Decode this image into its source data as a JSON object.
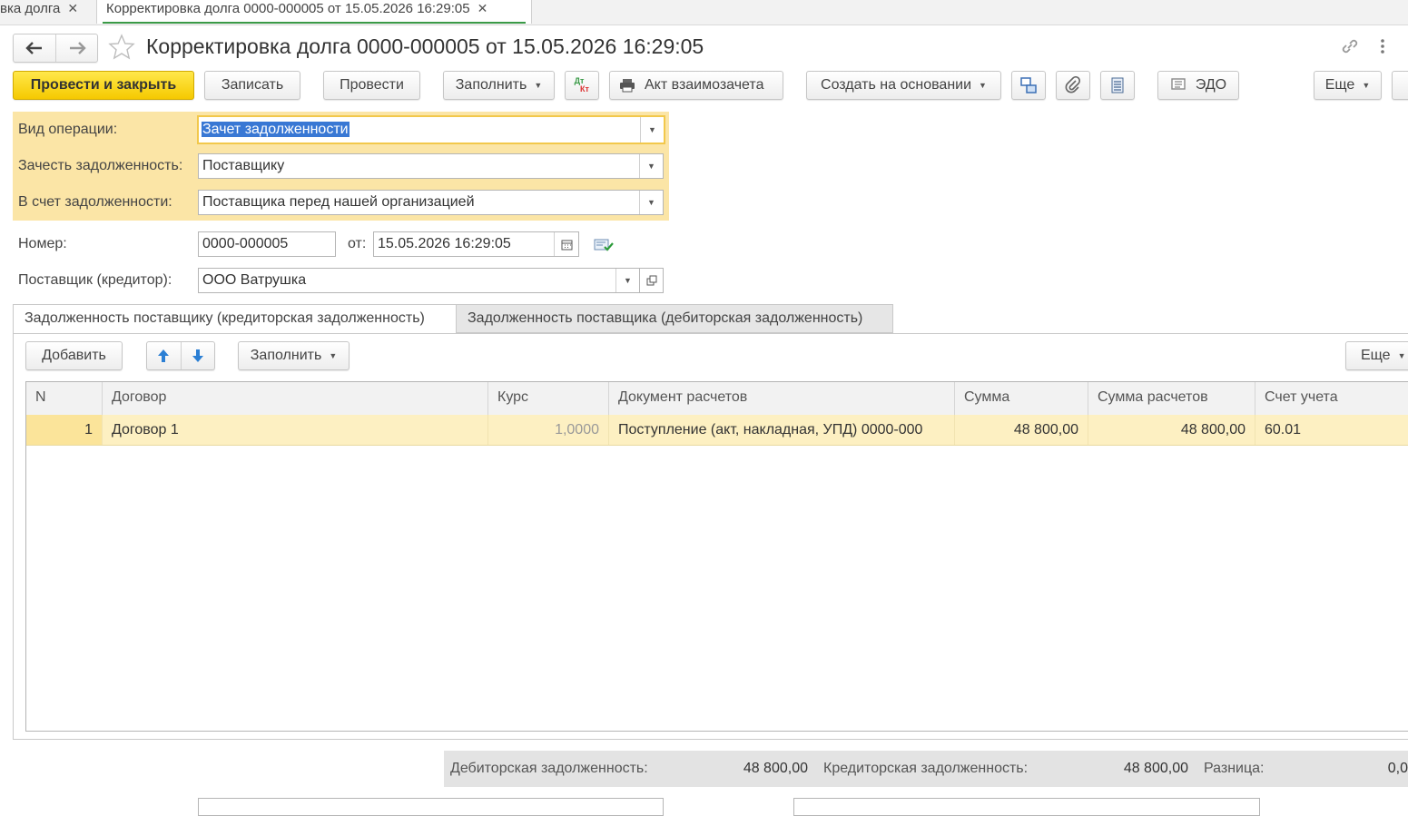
{
  "tabs": [
    {
      "label": "вка долга",
      "close": "✕"
    },
    {
      "label": "Корректировка долга 0000-000005 от 15.05.2026 16:29:05",
      "close": "✕"
    }
  ],
  "header": {
    "title": "Корректировка долга 0000-000005 от 15.05.2026 16:29:05",
    "back_icon": "arrow-left-icon",
    "forward_icon": "arrow-right-icon",
    "favorite_icon": "star-icon",
    "link_icon": "link-icon",
    "menu_icon": "more-vertical-icon"
  },
  "toolbar": {
    "post_close": "Провести и закрыть",
    "save": "Записать",
    "post": "Провести",
    "fill": "Заполнить",
    "dtkt_top": "Дт",
    "dtkt_bottom": "Кт",
    "act": "Акт взаимозачета",
    "create_based": "Создать на основании",
    "edo": "ЭДО",
    "more": "Еще"
  },
  "form": {
    "operation_label": "Вид операции:",
    "operation_value": "Зачет задолженности",
    "offset_label": "Зачесть задолженность:",
    "offset_value": "Поставщику",
    "against_label": "В счет задолженности:",
    "against_value": "Поставщика перед нашей организацией",
    "number_label": "Номер:",
    "number_value": "0000-000005",
    "date_label": "от:",
    "date_value": "15.05.2026 16:29:05",
    "supplier_label": "Поставщик (кредитор):",
    "supplier_value": "ООО Ватрушка"
  },
  "inner_tabs": {
    "tab1": "Задолженность поставщику (кредиторская задолженность)",
    "tab2": "Задолженность поставщика (дебиторская задолженность)"
  },
  "table_toolbar": {
    "add": "Добавить",
    "fill": "Заполнить",
    "more": "Еще"
  },
  "table": {
    "columns": [
      "N",
      "Договор",
      "Курс",
      "Документ расчетов",
      "Сумма",
      "Сумма расчетов",
      "Счет учета"
    ],
    "rows": [
      [
        "1",
        "Договор 1",
        "1,0000",
        "Поступление (акт, накладная, УПД) 0000-000",
        "48 800,00",
        "48 800,00",
        "60.01"
      ]
    ]
  },
  "totals": {
    "debit_label": "Дебиторская задолженность:",
    "debit_value": "48 800,00",
    "credit_label": "Кредиторская задолженность:",
    "credit_value": "48 800,00",
    "diff_label": "Разница:",
    "diff_value": "0,0"
  },
  "colors": {
    "primary_button": "#f5c900",
    "form_highlight": "#fbe5a6",
    "row_highlight": "#fdf0c2",
    "tab_accent": "#3a9a47"
  }
}
